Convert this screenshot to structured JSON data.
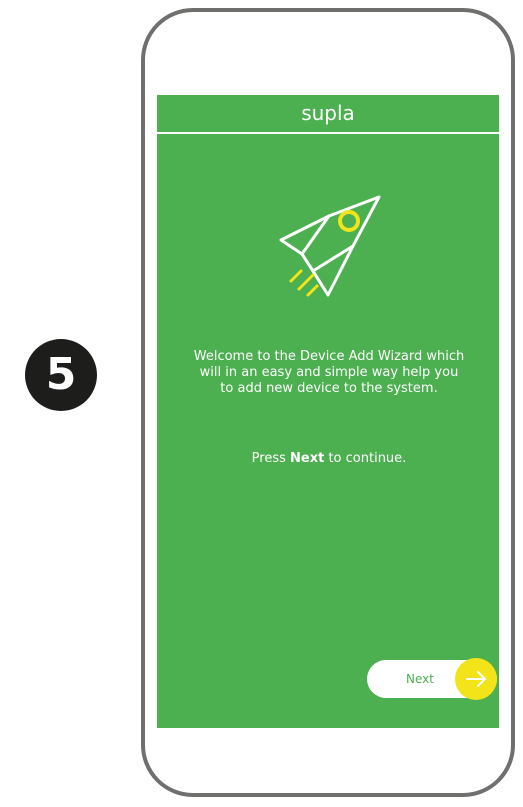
{
  "step": {
    "number": "5"
  },
  "app": {
    "title": "supla"
  },
  "wizard": {
    "welcome_text": "Welcome to the Device Add Wizard which will in an easy and simple way help you to add new device to the system.",
    "press_text": "Press ",
    "press_emphasis": "Next",
    "continue_text": " to continue.",
    "next_label": "Next"
  },
  "icons": {
    "hero": "rocket-icon",
    "next": "arrow-right-icon"
  },
  "colors": {
    "screen_background": "#4caf50",
    "accent": "#f2e419",
    "text": "#ffffff",
    "phone_frame": "#6f6f6e",
    "badge": "#1d1d1b"
  }
}
